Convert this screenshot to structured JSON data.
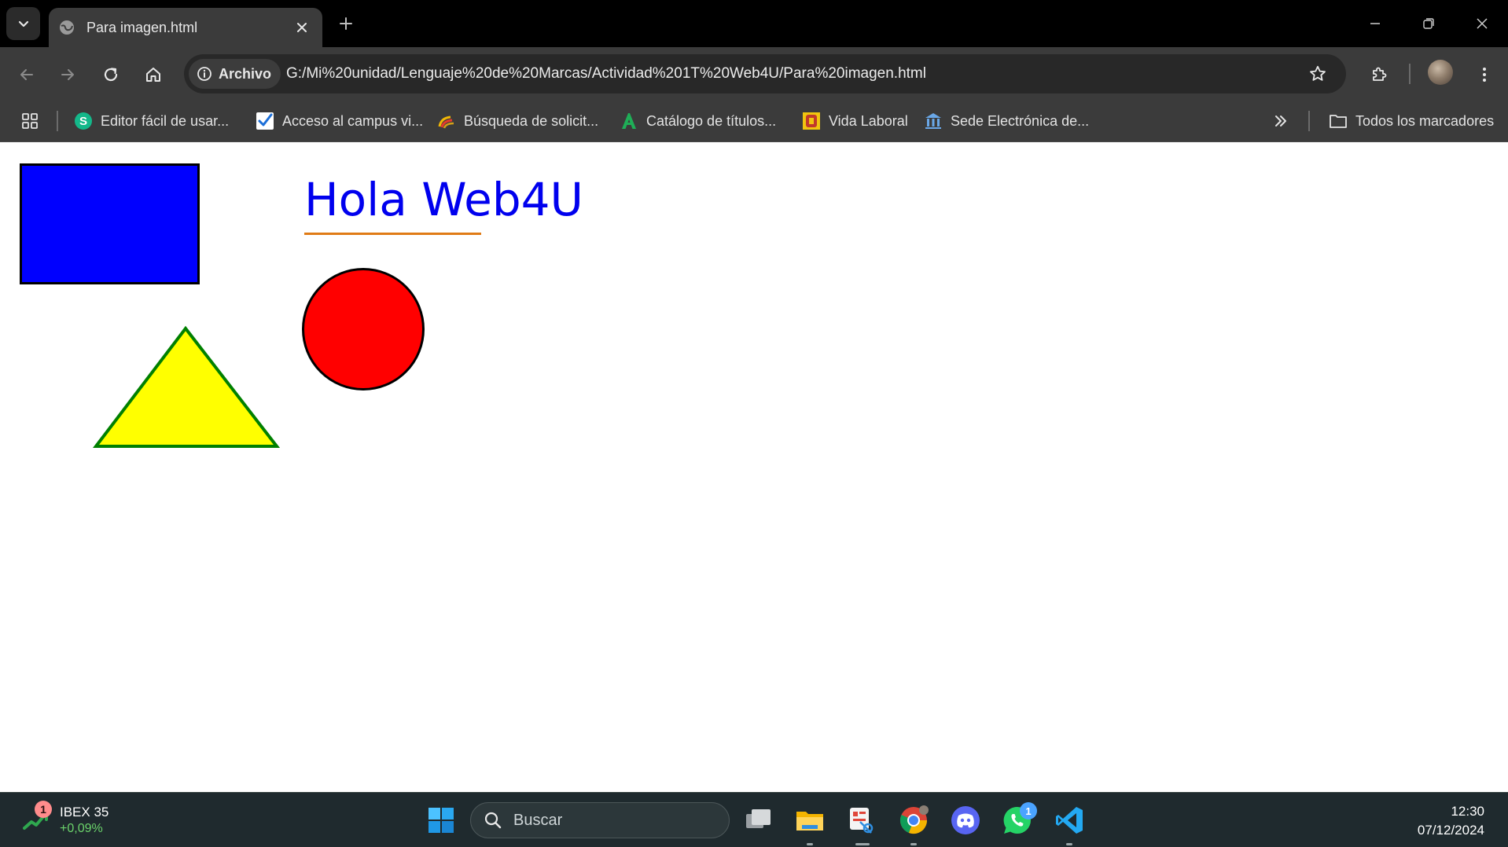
{
  "browser": {
    "tab": {
      "title": "Para imagen.html"
    },
    "address": {
      "chip_label": "Archivo",
      "url": "G:/Mi%20unidad/Lenguaje%20de%20Marcas/Actividad%201T%20Web4U/Para%20imagen.html"
    },
    "bookmarks": [
      {
        "label": "Editor fácil de usar...",
        "icon": "s-logo-icon"
      },
      {
        "label": "Acceso al campus vi...",
        "icon": "checkmark-icon"
      },
      {
        "label": "Búsqueda de solicit...",
        "icon": "rainbow-icon"
      },
      {
        "label": "Catálogo de títulos...",
        "icon": "a-logo-icon"
      },
      {
        "label": "Vida Laboral",
        "icon": "seal-icon"
      },
      {
        "label": "Sede Electrónica de...",
        "icon": "building-icon"
      }
    ],
    "all_bookmarks_label": "Todos los marcadores"
  },
  "page": {
    "heading": "Hola Web4U",
    "colors": {
      "rectangle_fill": "#0000ff",
      "rectangle_border": "#000000",
      "triangle_fill": "#ffff00",
      "triangle_border": "#008000",
      "circle_fill": "#ff0000",
      "circle_border": "#000000",
      "heading": "#0000ee",
      "underline": "#e07b16"
    }
  },
  "taskbar": {
    "widget": {
      "name": "IBEX 35",
      "change": "+0,09%",
      "badge": "1"
    },
    "search_placeholder": "Buscar",
    "whatsapp_badge": "1",
    "clock": {
      "time": "12:30",
      "date": "07/12/2024"
    }
  }
}
